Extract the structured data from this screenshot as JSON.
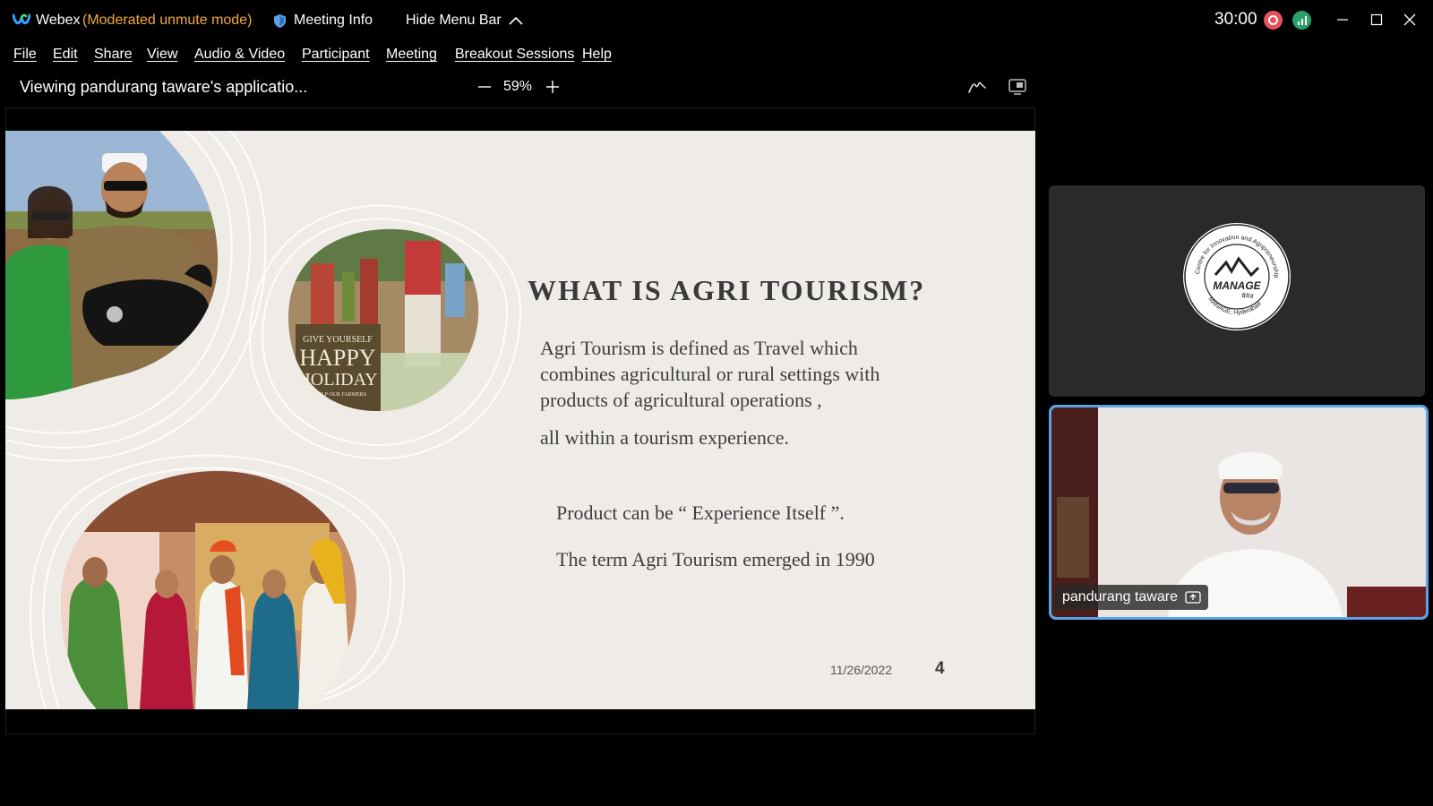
{
  "title_bar": {
    "app_name": "Webex",
    "mode": "(Moderated unmute mode)",
    "meeting_info": "Meeting Info",
    "hide_menu": "Hide Menu Bar",
    "timer": "30:00"
  },
  "menu": {
    "items": [
      {
        "label": "File"
      },
      {
        "label": "Edit"
      },
      {
        "label": "Share"
      },
      {
        "label": "View"
      },
      {
        "label": "Audio & Video"
      },
      {
        "label": "Participant"
      },
      {
        "label": "Meeting"
      },
      {
        "label": "Breakout Sessions"
      },
      {
        "label": "Help"
      }
    ]
  },
  "share_toolbar": {
    "viewing_text": "Viewing pandurang taware's applicatio...",
    "zoom": "59%"
  },
  "slide": {
    "image_caption": {
      "line1": "GIVE YOURSELF",
      "line2": "HAPPY",
      "line3": "HOLIDAY",
      "line4": "& HELP OUR FARMERS"
    },
    "title": "WHAT IS AGRI TOURISM?",
    "body": "Agri Tourism is  defined as Travel which combines agricultural or rural settings with products of agricultural operations ,",
    "line2": "all within a tourism experience.",
    "product": "Product can be “ Experience Itself ”.",
    "term": "The term Agri Tourism emerged in 1990",
    "date": "11/26/2022",
    "page_number": "4"
  },
  "participants": {
    "logo_panel": {
      "logo_ring_text": "Centre for Innovation and Agripreneurship (CIA)",
      "logo_bottom_text": "MANAGE, Hyderabad",
      "logo_center_text": "MANAGE",
      "logo_hindi_text": "मैनेज"
    },
    "video_panel": {
      "name": "pandurang taware"
    }
  },
  "colors": {
    "mode_orange": "#f2a93b",
    "recording_red": "#e8505b",
    "network_green": "#2aa06a",
    "active_speaker_border": "#5ba3e8",
    "slide_bg": "#efece7"
  },
  "icons": [
    "webex-logo-icon",
    "shield-icon",
    "chevron-up-icon",
    "record-icon",
    "network-stats-icon",
    "minimize-icon",
    "maximize-icon",
    "close-icon",
    "zoom-out-icon",
    "zoom-in-icon",
    "annotate-icon",
    "view-options-icon",
    "share-screen-icon"
  ]
}
